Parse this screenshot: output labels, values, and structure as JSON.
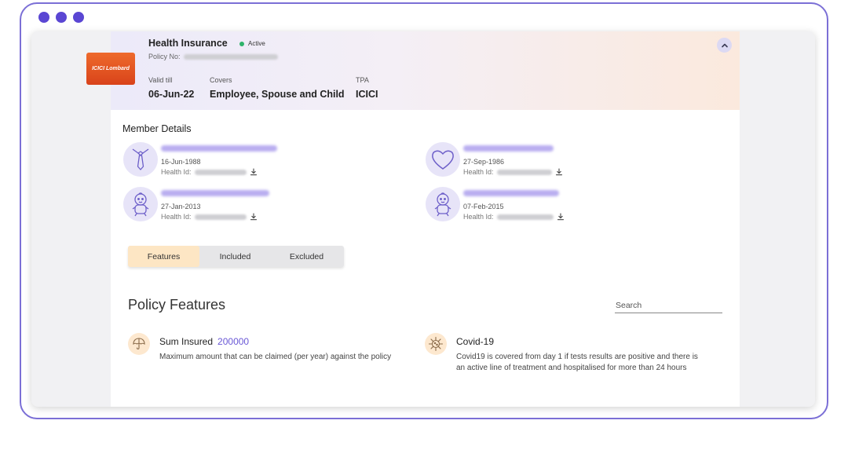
{
  "policy": {
    "title": "Health Insurance",
    "status": "Active",
    "policy_no_label": "Policy No:",
    "insurer_logo_text": "ICICI Lombard",
    "valid_till_label": "Valid till",
    "valid_till": "06-Jun-22",
    "covers_label": "Covers",
    "covers": "Employee, Spouse and Child",
    "tpa_label": "TPA",
    "tpa": "ICICI"
  },
  "members": {
    "title": "Member Details",
    "health_id_label": "Health Id:",
    "items": [
      {
        "dob": "16-Jun-1988",
        "icon": "tie-icon"
      },
      {
        "dob": "27-Sep-1986",
        "icon": "heart-icon"
      },
      {
        "dob": "27-Jan-2013",
        "icon": "baby-icon"
      },
      {
        "dob": "07-Feb-2015",
        "icon": "baby-icon"
      }
    ]
  },
  "tabs": [
    {
      "label": "Features",
      "active": true
    },
    {
      "label": "Included",
      "active": false
    },
    {
      "label": "Excluded",
      "active": false
    }
  ],
  "features": {
    "title": "Policy Features",
    "search_placeholder": "Search",
    "items": [
      {
        "title": "Sum Insured",
        "amount": "200000",
        "description": "Maximum amount that can be claimed (per year) against the policy",
        "icon": "umbrella-icon"
      },
      {
        "title": "Covid-19",
        "description": "Covid19 is covered from day 1 if tests results are positive and there is an active line of treatment and hospitalised for more than 24 hours",
        "icon": "virus-icon"
      }
    ]
  },
  "colors": {
    "accent": "#5a46d3",
    "tab_active": "#fde6c4",
    "status_active": "#2fb36b",
    "amount": "#6a58d6"
  }
}
